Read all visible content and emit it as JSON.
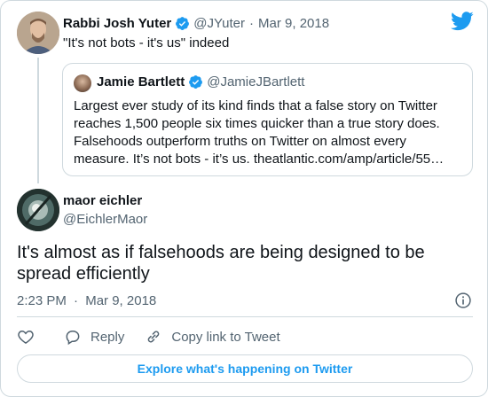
{
  "parent_tweet": {
    "name": "Rabbi Josh Yuter",
    "handle": "@JYuter",
    "separator": "·",
    "date": "Mar 9, 2018",
    "text": "\"It's not bots - it's us\" indeed",
    "verified": true
  },
  "quoted_tweet": {
    "name": "Jamie Bartlett",
    "handle": "@JamieJBartlett",
    "verified": true,
    "text": "Largest ever study of its kind finds that a false story on Twitter reaches 1,500 people six times quicker than a true story does. Falsehoods outperform truths on Twitter on almost every measure. It’s not bots - it’s us. theatlantic.com/amp/article/55…"
  },
  "main_tweet": {
    "name": "maor eichler",
    "handle": "@EichlerMaor",
    "text": "It's almost as if falsehoods are being designed to be spread efficiently",
    "time": "2:23 PM",
    "separator": "·",
    "date": "Mar 9, 2018"
  },
  "actions": {
    "reply_label": "Reply",
    "copy_link_label": "Copy link to Tweet"
  },
  "footer": {
    "explore_label": "Explore what's happening on Twitter"
  },
  "icons": {
    "brand": "twitter-bird-icon",
    "verified": "verified-badge-icon",
    "info": "info-icon",
    "like": "heart-icon",
    "reply": "reply-bubble-icon",
    "copy_link": "link-icon"
  },
  "colors": {
    "brand_blue": "#1d9bf0",
    "text_primary": "#0f1419",
    "text_secondary": "#536471",
    "border": "#cfd9de"
  }
}
